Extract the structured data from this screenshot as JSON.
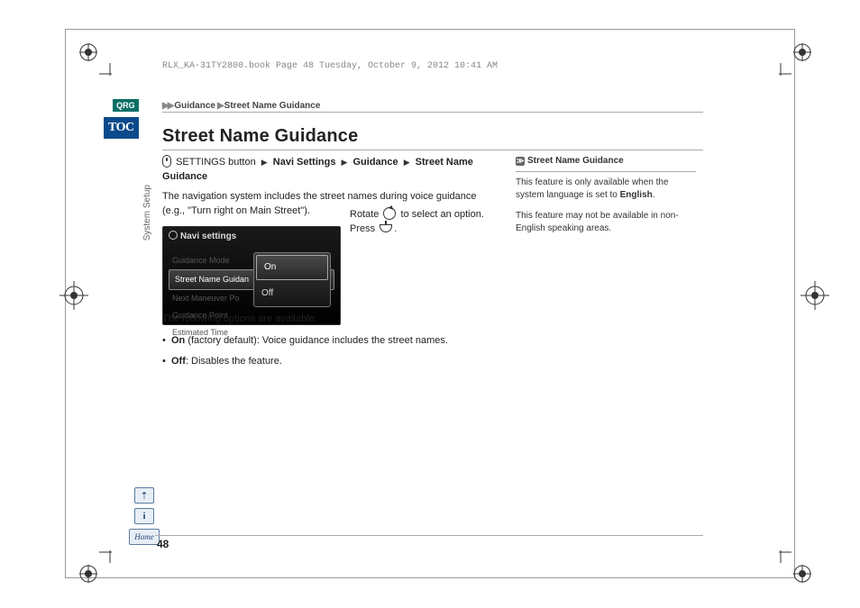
{
  "running_head": "RLX_KA-31TY2800.book  Page 48  Tuesday, October 9, 2012  10:41 AM",
  "breadcrumb": {
    "arrows": "▶▶",
    "seg1": "Guidance",
    "sep": "▶",
    "seg2": "Street Name Guidance"
  },
  "left_tabs": {
    "qrg": "QRG",
    "toc": "TOC",
    "section": "System Setup"
  },
  "title": "Street Name Guidance",
  "path": {
    "prefix": "SETTINGS button",
    "p1": "Navi Settings",
    "p2": "Guidance",
    "p3": "Street Name Guidance"
  },
  "intro": "The navigation system includes the street names during voice guidance (e.g., \"Turn right on Main Street\").",
  "screenshot": {
    "header": "Navi settings",
    "items": [
      "Guidance Mode",
      "Street Name Guidan",
      "Next Maneuver Po",
      "Guidance Point",
      "Estimated Time"
    ],
    "opts": [
      "On",
      "Off"
    ]
  },
  "rotate": {
    "line1_a": "Rotate ",
    "line1_b": " to select an option.",
    "line2_a": "Press ",
    "line2_b": "."
  },
  "options": {
    "lead": "The following options are available:",
    "opt1_b": "On",
    "opt1_t": " (factory default): Voice guidance includes the street names.",
    "opt2_b": "Off",
    "opt2_t": ": Disables the feature."
  },
  "sidebar": {
    "head": "Street Name Guidance",
    "p1a": "This feature is only available when the system language is set to ",
    "p1b": "English",
    "p1c": ".",
    "p2": "This feature may not be available in non-English speaking areas."
  },
  "icons": {
    "voice": "⇡",
    "info": "i",
    "home": "Home"
  },
  "page": "48"
}
